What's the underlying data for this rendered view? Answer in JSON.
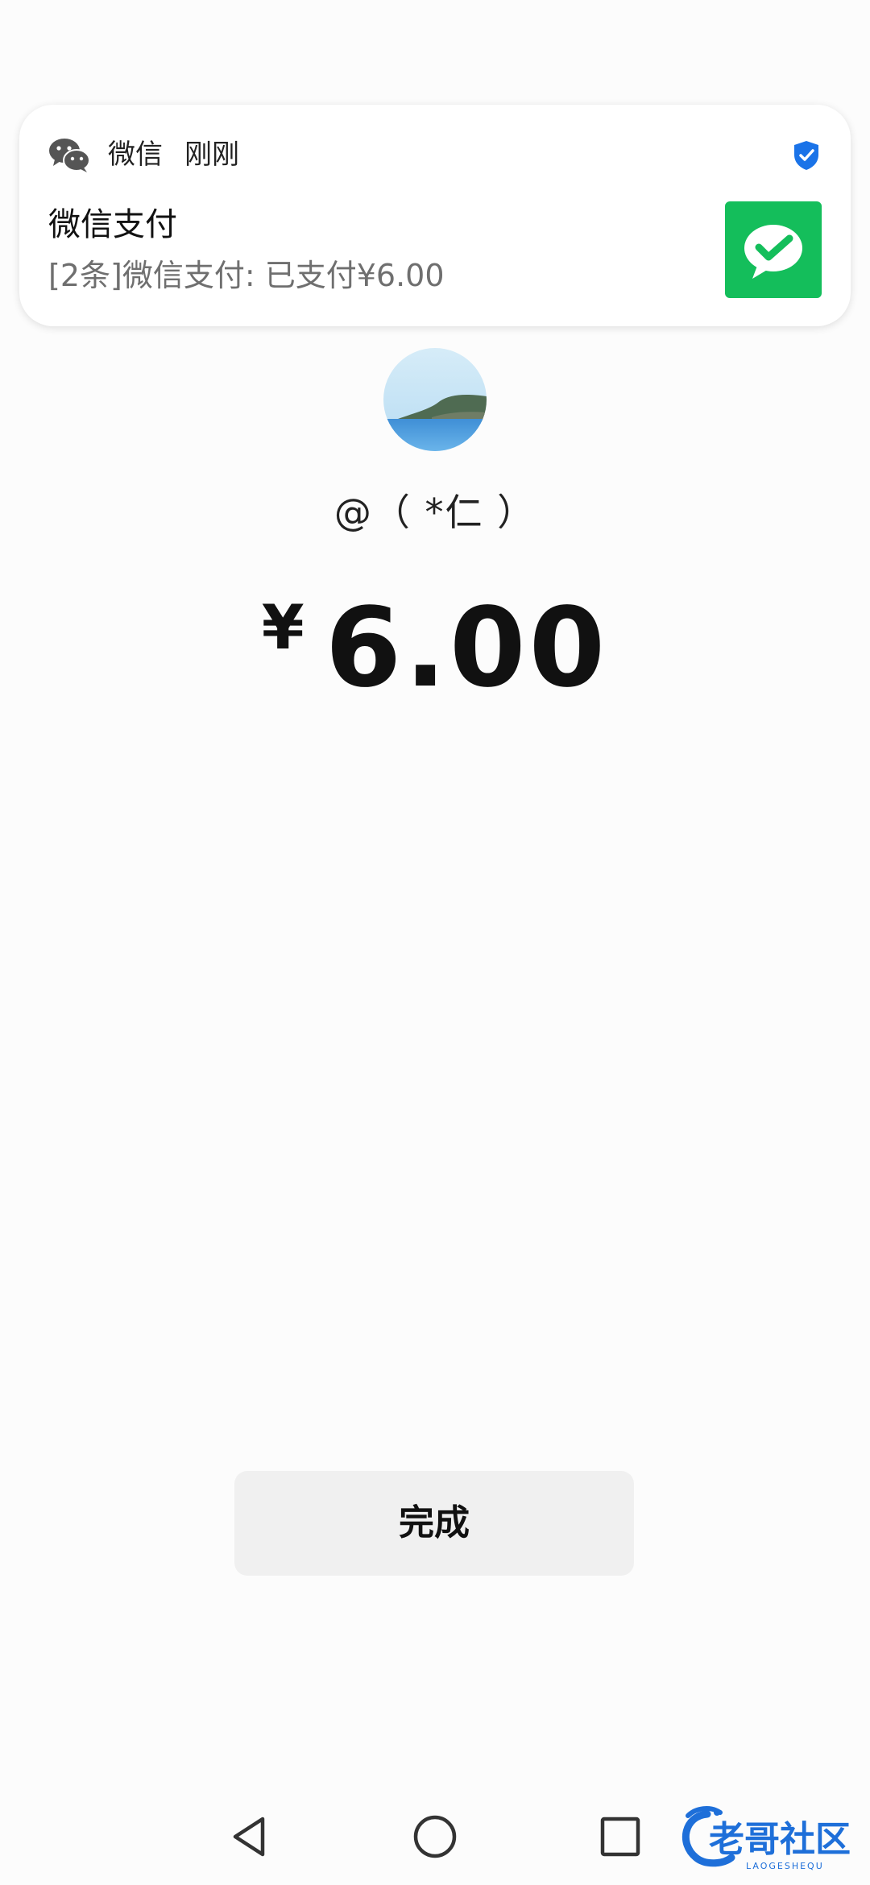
{
  "notification": {
    "app_name": "微信",
    "time": "刚刚",
    "title": "微信支付",
    "body": "[2条]微信支付: 已支付¥6.00",
    "icon_app": "wechat-logo-icon",
    "icon_badge": "verified-shield-icon",
    "icon_thumb": "wechat-pay-icon"
  },
  "payment": {
    "payee": "@（ *仁 ）",
    "currency_symbol": "¥",
    "amount": "6.00"
  },
  "actions": {
    "done_label": "完成"
  },
  "navigation": {
    "back_icon": "back-triangle-icon",
    "home_icon": "home-circle-icon",
    "recents_icon": "recents-square-icon"
  },
  "watermark": {
    "text": "老哥社区",
    "subtext": "LAOGESHEQU"
  },
  "colors": {
    "wechat_green": "#14be5b",
    "verified_blue": "#1a73e8",
    "button_bg": "#f0f0f0",
    "watermark_blue": "#1e6fd9"
  }
}
